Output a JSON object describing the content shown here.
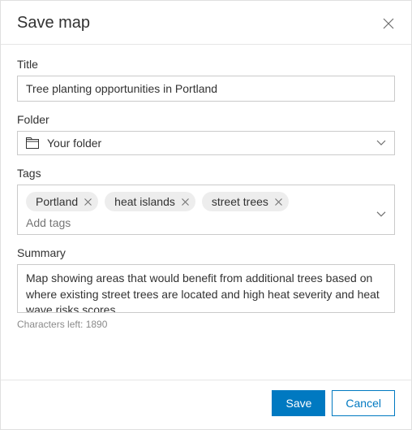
{
  "dialog": {
    "title": "Save map"
  },
  "form": {
    "title_label": "Title",
    "title_value": "Tree planting opportunities in Portland",
    "folder_label": "Folder",
    "folder_value": "Your folder",
    "tags_label": "Tags",
    "tags": [
      {
        "label": "Portland"
      },
      {
        "label": "heat islands"
      },
      {
        "label": "street trees"
      }
    ],
    "tags_placeholder": "Add tags",
    "summary_label": "Summary",
    "summary_value": "Map showing areas that would benefit from additional trees based on where existing street trees are located and high heat severity and heat wave risks scores.",
    "char_count": "Characters left: 1890"
  },
  "footer": {
    "save_label": "Save",
    "cancel_label": "Cancel"
  }
}
